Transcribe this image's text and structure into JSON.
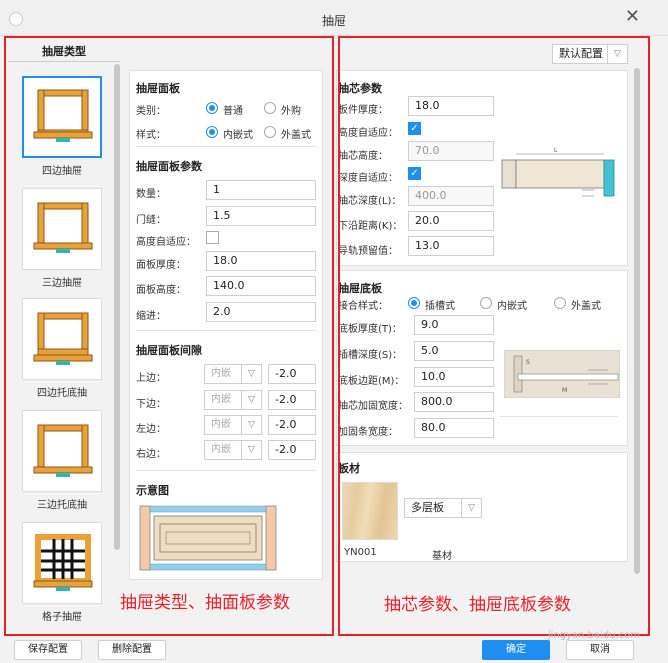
{
  "window": {
    "title": "抽屉"
  },
  "left_list": {
    "header": "抽屉类型",
    "items": [
      {
        "label": "四边抽屉",
        "selected": true
      },
      {
        "label": "三边抽屉",
        "selected": false
      },
      {
        "label": "四边托底抽",
        "selected": false
      },
      {
        "label": "三边托底抽",
        "selected": false
      },
      {
        "label": "格子抽屉",
        "selected": false
      }
    ]
  },
  "front_panel": {
    "title": "抽屉面板",
    "category_label": "类别：",
    "category_options": [
      "普通",
      "外购"
    ],
    "style_label": "样式：",
    "style_options": [
      "内嵌式",
      "外盖式"
    ]
  },
  "front_params": {
    "title": "抽屉面板参数",
    "fields": [
      {
        "label": "数量：",
        "value": "1"
      },
      {
        "label": "门缝：",
        "value": "1.5"
      },
      {
        "label": "高度自适应：",
        "value": ""
      },
      {
        "label": "面板厚度：",
        "value": "18.0"
      },
      {
        "label": "面板高度：",
        "value": "140.0"
      },
      {
        "label": "缩进：",
        "value": "2.0"
      }
    ]
  },
  "gaps": {
    "title": "抽屉面板间隙",
    "rows": [
      {
        "label": "上边：",
        "mode": "内嵌",
        "value": "-2.0"
      },
      {
        "label": "下边：",
        "mode": "内嵌",
        "value": "-2.0"
      },
      {
        "label": "左边：",
        "mode": "内嵌",
        "value": "-2.0"
      },
      {
        "label": "右边：",
        "mode": "内嵌",
        "value": "-2.0"
      }
    ]
  },
  "schematic": {
    "title": "示意图"
  },
  "annotations": {
    "left": "抽屉类型、抽面板参数",
    "right": "抽芯参数、抽屉底板参数"
  },
  "config": {
    "selected": "默认配置"
  },
  "core": {
    "title": "抽芯参数",
    "fields": [
      {
        "label": "板件厚度：",
        "value": "18.0"
      },
      {
        "label": "高度自适应：",
        "value": ""
      },
      {
        "label": "抽芯高度：",
        "value": "70.0"
      },
      {
        "label": "深度自适应：",
        "value": ""
      },
      {
        "label": "抽芯深度(L)：",
        "value": "400.0"
      },
      {
        "label": "下沿距离(K)：",
        "value": "20.0"
      },
      {
        "label": "导轨预留值：",
        "value": "13.0"
      }
    ],
    "diagram_label": "L"
  },
  "bottom": {
    "title": "抽屉底板",
    "join_label": "接合样式：",
    "join_options": [
      "插槽式",
      "内嵌式",
      "外盖式"
    ],
    "fields": [
      {
        "label": "底板厚度(T)：",
        "value": "9.0"
      },
      {
        "label": "插槽深度(S)：",
        "value": "5.0"
      },
      {
        "label": "底板边距(M)：",
        "value": "10.0"
      },
      {
        "label": "抽芯加固宽度：",
        "value": "800.0"
      },
      {
        "label": "加固条宽度：",
        "value": "80.0"
      }
    ],
    "diagram_labels": {
      "s": "S",
      "m": "M"
    }
  },
  "material": {
    "title": "板材",
    "code": "YN001",
    "type_select": "多层板",
    "base_label": "基材"
  },
  "footer": {
    "save": "保存配置",
    "delete": "删除配置",
    "ok": "确定",
    "cancel": "取消"
  },
  "watermark": "jingyan.baidu.com",
  "colors": {
    "accent": "#1e8ef0",
    "annotation": "#e8202a",
    "drawer_frame": "#e9a23b",
    "drawer_bottom": "#2bb8b8"
  }
}
